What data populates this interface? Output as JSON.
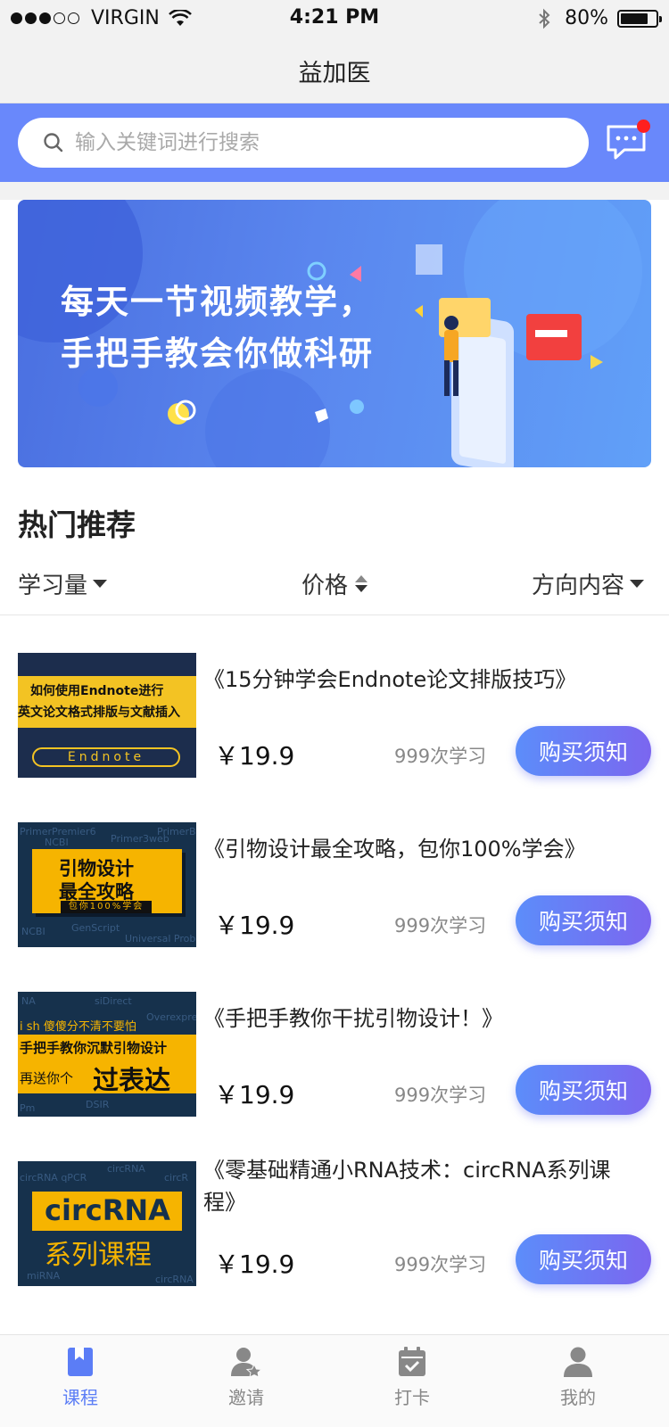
{
  "status_bar": {
    "carrier": "VIRGIN",
    "time": "4:21 PM",
    "battery": "80%",
    "battery_level": 0.8
  },
  "nav": {
    "title": "益加医"
  },
  "search": {
    "placeholder": "输入关键词进行搜索",
    "has_unread_messages": true
  },
  "banner": {
    "line1": "每天一节视频教学，",
    "line2": "手把手教会你做科研"
  },
  "section": {
    "title": "热门推荐"
  },
  "filters": {
    "study": "学习量",
    "price": "价格",
    "direction": "方向内容"
  },
  "courses": [
    {
      "title": "《15分钟学会Endnote论文排版技巧》",
      "price": "￥19.9",
      "students": "999次学习",
      "button": "购买须知",
      "thumb": {
        "line1": "如何使用Endnote进行",
        "line2": "英文论文格式排版与文献插入",
        "pill": "Endnote"
      }
    },
    {
      "title": "《引物设计最全攻略，包你100%学会》",
      "price": "￥19.9",
      "students": "999次学习",
      "button": "购买须知",
      "thumb": {
        "line1": "引物设计",
        "line2": "最全攻略",
        "tag": "包你100%学会"
      }
    },
    {
      "title": "《手把手教你干扰引物设计！》",
      "price": "￥19.9",
      "students": "999次学习",
      "button": "购买须知",
      "thumb": {
        "line0": "i sh 傻傻分不清不要怕",
        "line1": "手把手教你沉默引物设计",
        "line2a": "再送你个",
        "line2b": "过表达"
      }
    },
    {
      "title": "《零基础精通小RNA技术：circRNA系列课程》",
      "price": "￥19.9",
      "students": "999次学习",
      "button": "购买须知",
      "thumb": {
        "line1": "circRNA",
        "line2": "系列课程"
      }
    }
  ],
  "tabs": [
    {
      "label": "课程",
      "icon": "book-icon",
      "active": true
    },
    {
      "label": "邀请",
      "icon": "invite-user-icon",
      "active": false
    },
    {
      "label": "打卡",
      "icon": "calendar-check-icon",
      "active": false
    },
    {
      "label": "我的",
      "icon": "user-icon",
      "active": false
    }
  ],
  "colors": {
    "accent": "#6988fb",
    "button_gradient_start": "#5c8dfa",
    "button_gradient_end": "#7b66ef",
    "active_tab": "#5b7df6",
    "notification_dot": "#ff1f1f"
  }
}
